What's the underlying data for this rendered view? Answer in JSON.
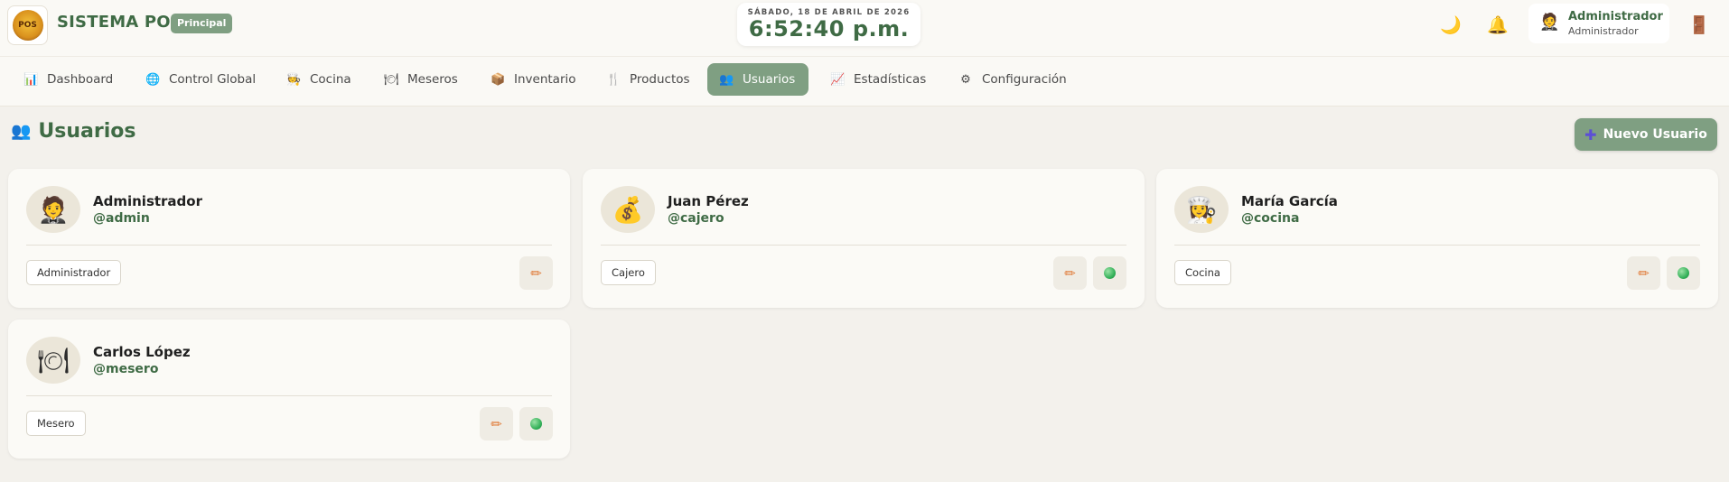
{
  "app": {
    "title": "SISTEMA POS",
    "badge": "Principal",
    "logo_icon": "pos-logo"
  },
  "clock": {
    "date": "SÁBADO, 18 DE ABRIL DE 2026",
    "time": "6:52:40 p.m."
  },
  "header": {
    "theme_icon": "moon-icon",
    "notifications_icon": "bell-icon",
    "logout_icon": "door-icon",
    "user": {
      "name": "Administrador",
      "role": "Administrador"
    }
  },
  "nav": {
    "items": [
      {
        "label": "Dashboard",
        "icon": "📊"
      },
      {
        "label": "Control Global",
        "icon": "🌐"
      },
      {
        "label": "Cocina",
        "icon": "🧑‍🍳"
      },
      {
        "label": "Meseros",
        "icon": "🍽"
      },
      {
        "label": "Inventario",
        "icon": "📦"
      },
      {
        "label": "Productos",
        "icon": "🍴"
      },
      {
        "label": "Usuarios",
        "icon": "👥"
      },
      {
        "label": "Estadísticas",
        "icon": "📈"
      },
      {
        "label": "Configuración",
        "icon": "⚙"
      }
    ],
    "active": "Usuarios"
  },
  "page": {
    "title": "Usuarios",
    "title_icon": "👥",
    "new_button": "Nuevo Usuario",
    "new_button_icon": "✚"
  },
  "users": [
    {
      "name": "Administrador",
      "username": "@admin",
      "role": "Administrador",
      "avatar": "🤵",
      "has_toggle": false
    },
    {
      "name": "Juan Pérez",
      "username": "@cajero",
      "role": "Cajero",
      "avatar": "💰",
      "has_toggle": true
    },
    {
      "name": "María García",
      "username": "@cocina",
      "role": "Cocina",
      "avatar": "👩‍🍳",
      "has_toggle": true
    },
    {
      "name": "Carlos López",
      "username": "@mesero",
      "role": "Mesero",
      "avatar": "🍽",
      "has_toggle": true
    }
  ],
  "colors": {
    "brand": "#3f6b45",
    "accent": "#7f9f82",
    "background": "#f3f1ec",
    "edit": "#e07b39",
    "active_dot": "#2fae55"
  }
}
